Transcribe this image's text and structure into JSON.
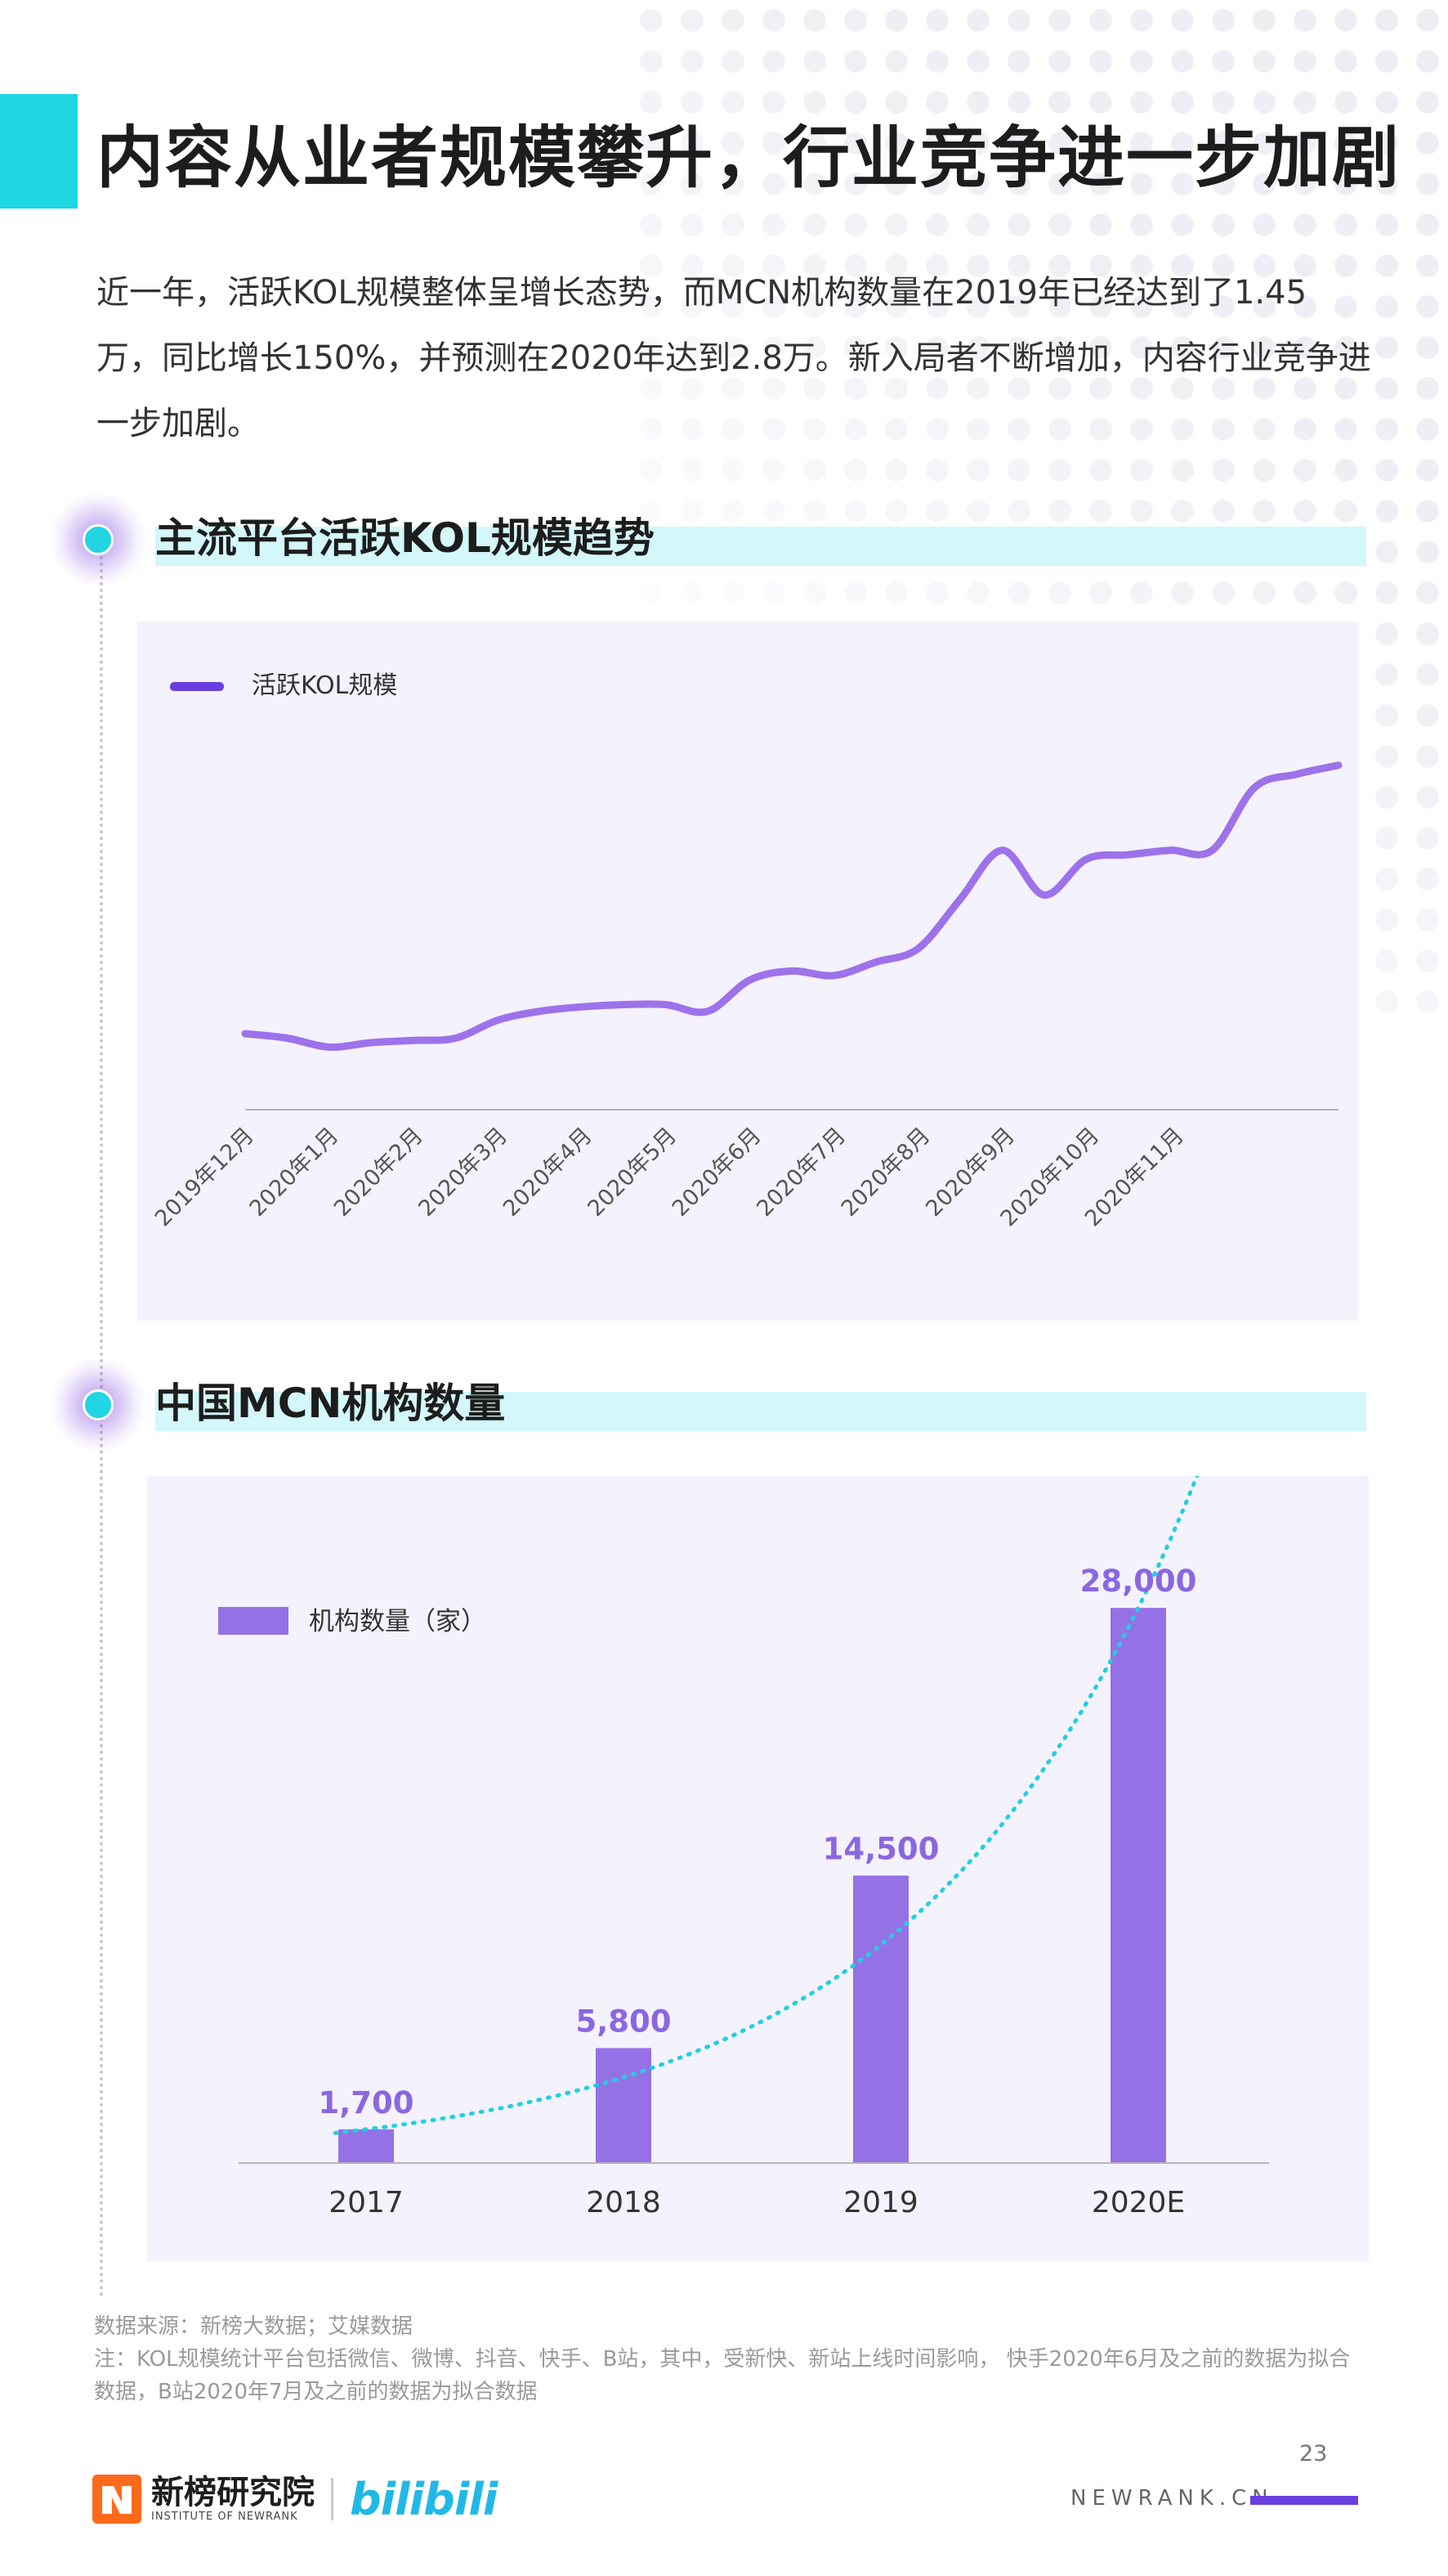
{
  "page": {
    "title": "内容从业者规模攀升，行业竞争进一步加剧",
    "intro": "近一年，活跃KOL规模整体呈增长态势，而MCN机构数量在2019年已经达到了1.45万，同比增长150%，并预测在2020年达到2.8万。新入局者不断增加，内容行业竞争进一步加剧。"
  },
  "sections": {
    "kol": {
      "title": "主流平台活跃KOL规模趋势"
    },
    "mcn": {
      "title": "中国MCN机构数量"
    }
  },
  "colors": {
    "accent_cyan": "#1fd6e3",
    "section_band": "#d3f7fa",
    "panel_bg": "#f4f2fd",
    "kol_line": "#9d72ea",
    "kol_legend": "#6a3fe0",
    "bar": "#9571e6",
    "bar_label": "#8b67e0",
    "trend": "#22cfe0"
  },
  "chart_data": [
    {
      "type": "line",
      "title": "",
      "legend": {
        "position": "top-left",
        "entries": [
          "活跃KOL规模"
        ]
      },
      "x_labels": [
        "2019年12月",
        "2020年1月",
        "2020年2月",
        "2020年3月",
        "2020年4月",
        "2020年5月",
        "2020年6月",
        "2020年7月",
        "2020年8月",
        "2020年9月",
        "2020年10月",
        "2020年11月"
      ],
      "y_axis": {
        "shown": false,
        "ylim": [
          0,
          100
        ]
      },
      "grid": false,
      "series": [
        {
          "name": "活跃KOL规模",
          "values": [
            17,
            16,
            14,
            15,
            15.5,
            16,
            20,
            22,
            23,
            23.5,
            23.5,
            22,
            29,
            31,
            30,
            33,
            36,
            47,
            58,
            48,
            56,
            57,
            58,
            58,
            72,
            75,
            77
          ]
        }
      ]
    },
    {
      "type": "bar",
      "title": "",
      "legend": {
        "position": "top-left",
        "entries": [
          "机构数量（家）"
        ]
      },
      "categories": [
        "2017",
        "2018",
        "2019",
        "2020E"
      ],
      "series": [
        {
          "name": "机构数量（家）",
          "values": [
            1700,
            5800,
            14500,
            28000
          ]
        }
      ],
      "data_labels": [
        "1,700",
        "5,800",
        "14,500",
        "28,000"
      ],
      "ylim": [
        0,
        33000
      ],
      "grid": false,
      "trendline": "exponential, dotted"
    }
  ],
  "footnotes": {
    "source": "数据来源：新榜大数据；艾媒数据",
    "note": "注：KOL规模统计平台包括微信、微博、抖音、快手、B站，其中，受新快、新站上线时间影响， 快手2020年6月及之前的数据为拟合数据，B站2020年7月及之前的数据为拟合数据"
  },
  "footer": {
    "page_number": "23",
    "site": "NEWRANK.CN",
    "brand_name": "新榜研究院",
    "brand_sub": "INSTITUTE OF NEWRANK",
    "partner": "bilibili"
  }
}
